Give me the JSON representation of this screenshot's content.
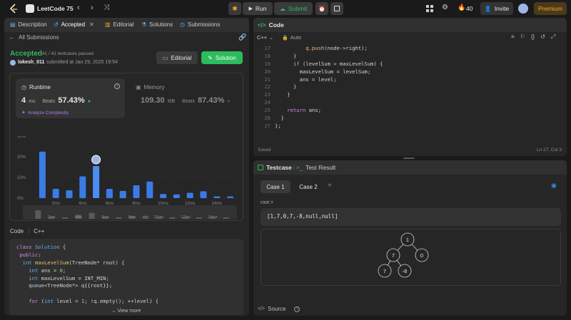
{
  "topbar": {
    "title": "LeetCode 75",
    "run_label": "Run",
    "submit_label": "Submit",
    "streak": "40",
    "invite_label": "Invite",
    "premium_label": "Premium"
  },
  "left": {
    "tabs": [
      {
        "label": "Description"
      },
      {
        "label": "Accepted"
      },
      {
        "label": "Editorial"
      },
      {
        "label": "Solutions"
      },
      {
        "label": "Submissions"
      }
    ],
    "back_label": "All Submissions",
    "status": "Accepted",
    "testcases": "41 / 41 testcases passed",
    "username": "lokesh_011",
    "submitted": "submitted at Jan 29, 2025 19:54",
    "editorial_button": "Editorial",
    "solution_button": "Solution",
    "runtime_label": "Runtime",
    "runtime_value": "4",
    "runtime_unit": "ms",
    "runtime_beats_label": "Beats",
    "runtime_beats": "57.43%",
    "analyze_label": "Analyze Complexity",
    "memory_label": "Memory",
    "memory_value": "109.30",
    "memory_unit": "MB",
    "memory_beats_label": "Beats",
    "memory_beats": "87.43%",
    "code_label": "Code",
    "code_lang": "C++",
    "code_lines": [
      "class Solution {",
      "public:",
      "    int maxLevelSum(TreeNode* root) {",
      "        int ans = 0;",
      "        int maxLevelSum = INT_MIN;",
      "        queue<TreeNode*> q{{root}};",
      "",
      "        for (int level = 1; !q.empty(); ++level) {"
    ],
    "view_more": "View more"
  },
  "chart_data": {
    "type": "bar",
    "yticks": [
      "30%",
      "20%",
      "10%",
      "0%"
    ],
    "ylim": [
      0,
      30
    ],
    "xticks": [
      "2ms",
      "4ms",
      "6ms",
      "8ms",
      "10ms",
      "12ms",
      "14ms"
    ],
    "values": [
      22.5,
      4.5,
      3.8,
      10.5,
      15.5,
      4.5,
      3.5,
      6.2,
      8,
      2,
      1.8,
      2.6,
      3.3,
      0.8,
      0.8
    ],
    "selected_index": 4,
    "colors": {
      "bar": "#3a7ce6",
      "selected": "#4d8cf5"
    }
  },
  "right": {
    "code_tab": "Code",
    "lang": "C++",
    "auto_label": "Auto",
    "lines": [
      {
        "n": "17",
        "text": "            q.push(node->right);"
      },
      {
        "n": "18",
        "text": "        }"
      },
      {
        "n": "19",
        "text": "        if (levelSum > maxLevelSum) {"
      },
      {
        "n": "20",
        "text": "            maxLevelSum = levelSum;"
      },
      {
        "n": "21",
        "text": "            ans = level;"
      },
      {
        "n": "22",
        "text": "        }"
      },
      {
        "n": "23",
        "text": "    }"
      },
      {
        "n": "24",
        "text": ""
      },
      {
        "n": "25",
        "text": "    return ans;"
      },
      {
        "n": "26",
        "text": "  }"
      },
      {
        "n": "27",
        "text": "};"
      }
    ],
    "saved": "Saved",
    "cursor": "Ln 27, Col 3",
    "testcase_tab": "Testcase",
    "result_tab": "Test Result",
    "case1": "Case 1",
    "case2": "Case 2",
    "root_label": "root =",
    "root_value": "[1,7,0,7,-8,null,null]",
    "tree_nodes": [
      "1",
      "7",
      "0",
      "7",
      "-8"
    ],
    "source_label": "Source"
  }
}
